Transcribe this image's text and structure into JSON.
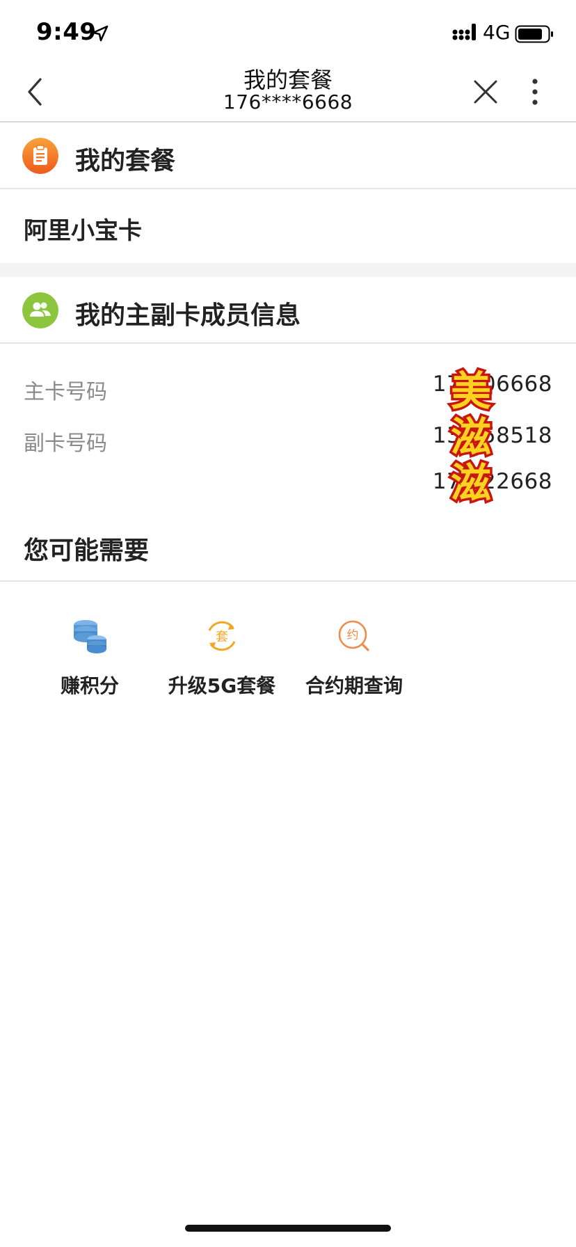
{
  "status_bar": {
    "time": "9:49",
    "network": "4G",
    "icons": [
      "location-arrow-icon",
      "signal-icon",
      "battery-icon"
    ]
  },
  "nav": {
    "title": "我的套餐",
    "subtitle": "176****6668",
    "icons": [
      "back-icon",
      "close-icon",
      "more-icon"
    ]
  },
  "plan_section": {
    "title": "我的套餐",
    "icon": "clipboard-icon",
    "icon_color": "#f47a1f",
    "plan_name": "阿里小宝卡"
  },
  "members_section": {
    "title": "我的主副卡成员信息",
    "icon": "people-icon",
    "icon_color": "#8cc63f",
    "primary_label": "主卡号码",
    "primary_number": "176    06668",
    "secondary_label": "副卡号码",
    "secondary_numbers": [
      "132    58518",
      "176    22668"
    ]
  },
  "sticker": {
    "text": "美滋滋",
    "colors": [
      "#ffd21f",
      "#e0201a"
    ]
  },
  "suggestions": {
    "title": "您可能需要",
    "items": [
      {
        "label": "赚积分",
        "icon": "coins-icon",
        "color": "#5b9bd5"
      },
      {
        "label": "升级5G套餐",
        "icon": "upgrade-plan-icon",
        "glyph": "套",
        "color": "#f5a623"
      },
      {
        "label": "合约期查询",
        "icon": "contract-search-icon",
        "glyph": "约",
        "color": "#f08c4a"
      }
    ]
  }
}
